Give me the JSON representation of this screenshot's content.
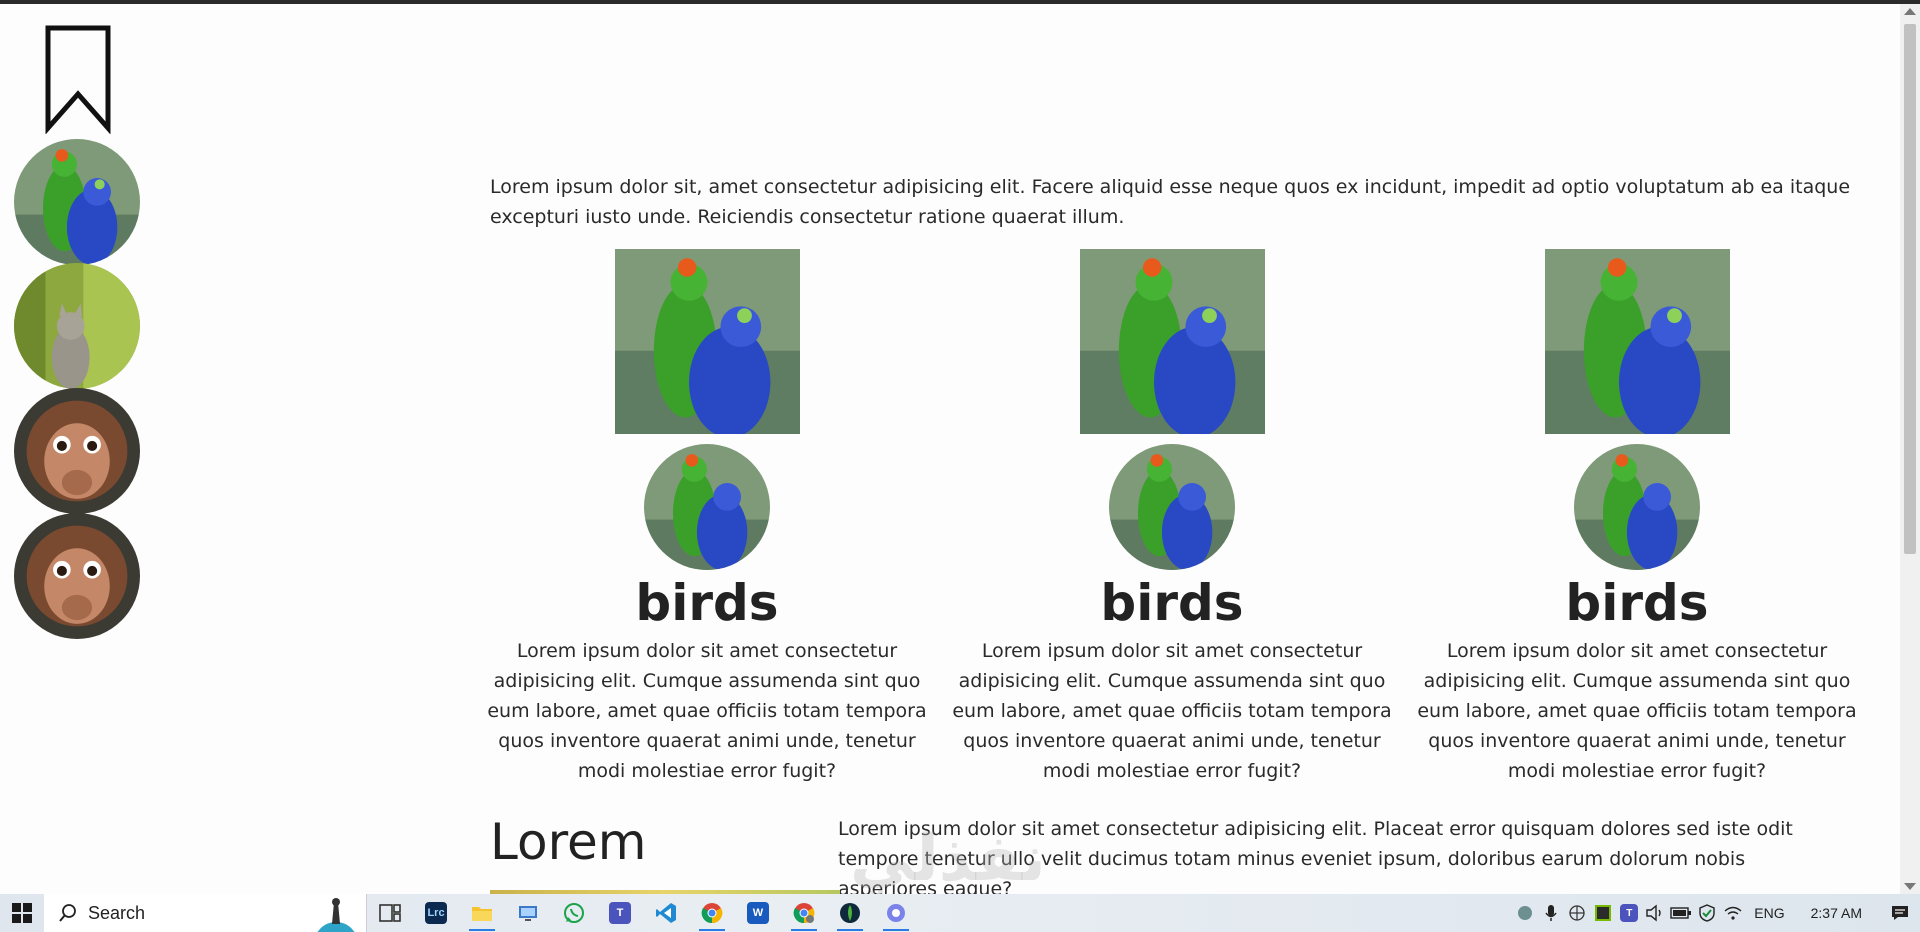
{
  "sidebar": {
    "avatars": [
      "birds",
      "cat",
      "monkey",
      "monkey"
    ]
  },
  "main": {
    "intro": "Lorem ipsum dolor sit, amet consectetur adipisicing elit. Facere aliquid esse neque quos ex incidunt, impedit ad optio voluptatum ab ea itaque excepturi iusto unde. Reiciendis consectetur ratione quaerat illum.",
    "cards": [
      {
        "title": "birds",
        "text": "Lorem ipsum dolor sit amet consectetur adipisicing elit. Cumque assumenda sint quo eum labore, amet quae officiis totam tempora quos inventore quaerat animi unde, tenetur modi molestiae error fugit?"
      },
      {
        "title": "birds",
        "text": "Lorem ipsum dolor sit amet consectetur adipisicing elit. Cumque assumenda sint quo eum labore, amet quae officiis totam tempora quos inventore quaerat animi unde, tenetur modi molestiae error fugit?"
      },
      {
        "title": "birds",
        "text": "Lorem ipsum dolor sit amet consectetur adipisicing elit. Cumque assumenda sint quo eum labore, amet quae officiis totam tempora quos inventore quaerat animi unde, tenetur modi molestiae error fugit?"
      }
    ],
    "bottom_heading": "Lorem",
    "bottom_text": "Lorem ipsum dolor sit amet consectetur adipisicing elit. Placeat error quisquam dolores sed iste odit tempore tenetur ullo velit ducimus totam minus eveniet ipsum, doloribus earum dolorum nobis asperiores eaque?",
    "watermark": "نفذلي"
  },
  "taskbar": {
    "search_label": "Search",
    "apps": [
      "task-view",
      "lightroom-classic",
      "file-explorer",
      "remote-desktop",
      "whatsapp",
      "teams",
      "vscode",
      "chrome",
      "word",
      "chrome-profile",
      "mongodb-compass",
      "teams-chat"
    ],
    "language": "ENG",
    "time": "2:37 AM"
  }
}
